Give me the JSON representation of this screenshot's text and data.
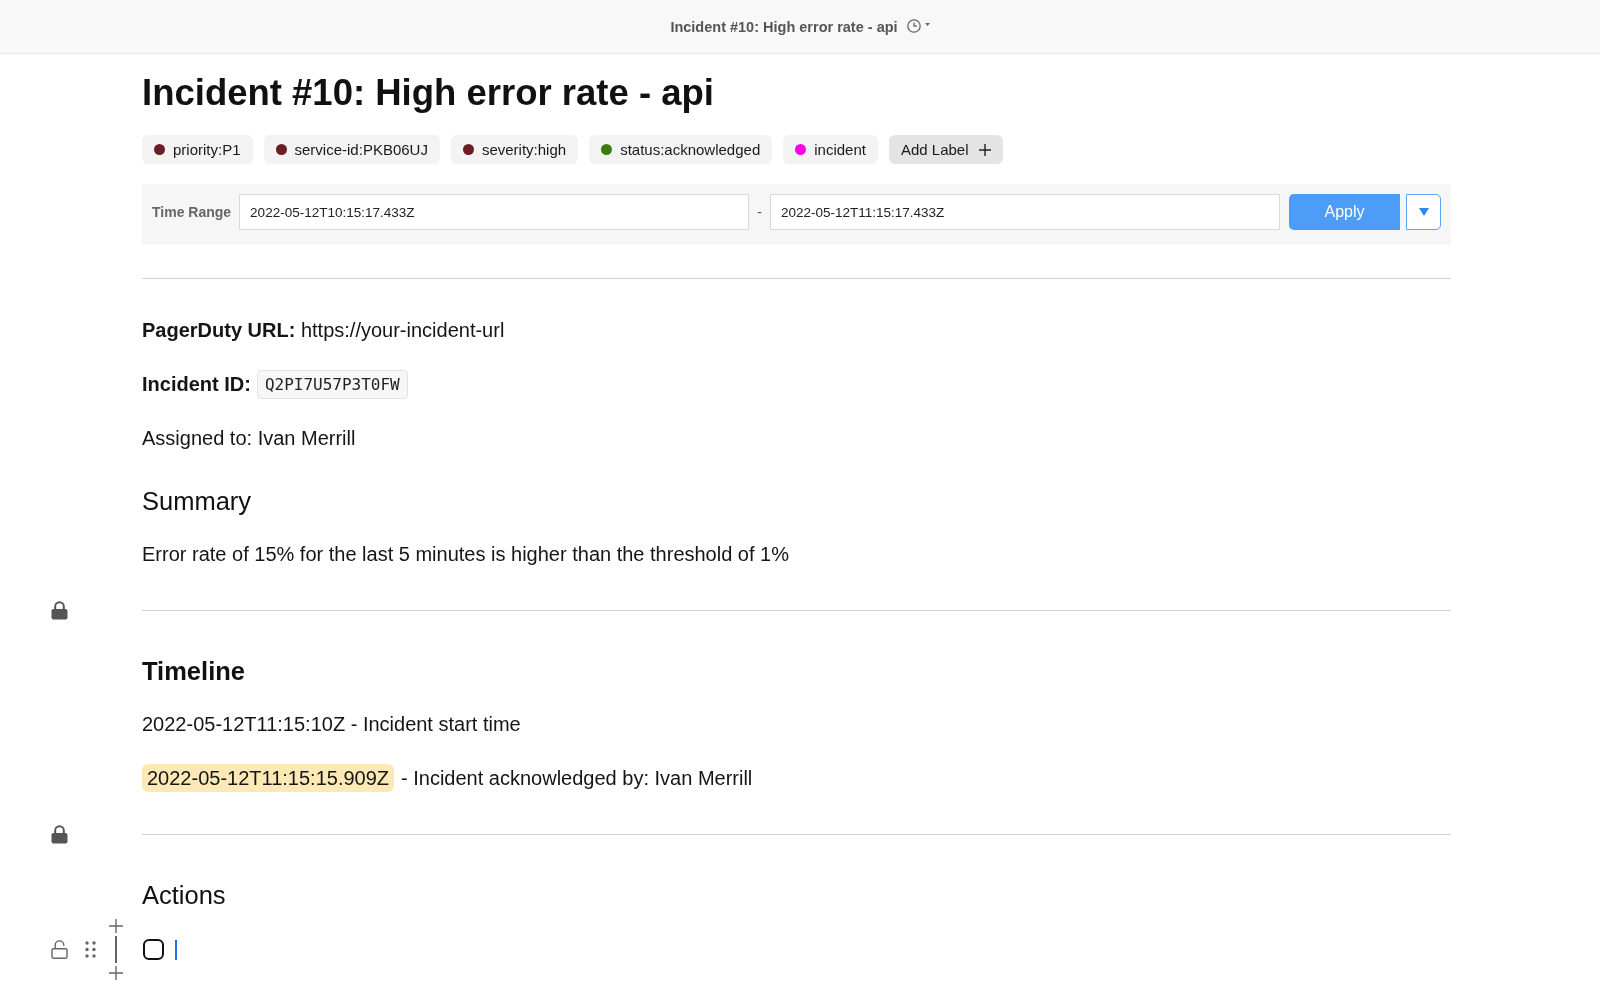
{
  "window": {
    "title": "Incident #10: High error rate - api"
  },
  "document": {
    "title": "Incident #10: High error rate - api",
    "labels": [
      {
        "text": "priority:P1",
        "color": "#6b1d26"
      },
      {
        "text": "service-id:PKB06UJ",
        "color": "#6b1d26"
      },
      {
        "text": "severity:high",
        "color": "#6b1d26"
      },
      {
        "text": "status:acknowledged",
        "color": "#3f7a0c"
      },
      {
        "text": "incident",
        "color": "#ff00e6"
      }
    ],
    "add_label_button": "Add Label",
    "time_range": {
      "label": "Time Range",
      "start": "2022-05-12T10:15:17.433Z",
      "separator": "-",
      "end": "2022-05-12T11:15:17.433Z",
      "apply_button": "Apply"
    },
    "blocks": [
      {
        "kind": "divider"
      },
      {
        "kind": "text",
        "text": "**PagerDuty URL:** https://your-incident-url"
      },
      {
        "kind": "code_field",
        "label": "Incident ID:",
        "code": "Q2PI7U57P3T0FW"
      },
      {
        "kind": "text",
        "text": "Assigned to: Ivan Merrill"
      },
      {
        "kind": "heading",
        "text": "Summary",
        "bold": false
      },
      {
        "kind": "text",
        "text": "Error rate of 15% for the last 5 minutes is higher than the threshold of 1%"
      },
      {
        "kind": "divider",
        "locked": true
      },
      {
        "kind": "heading",
        "text": "Timeline",
        "bold": true
      },
      {
        "kind": "text",
        "text": "2022-05-12T11:15:10Z - Incident start time"
      },
      {
        "kind": "timestamp_text",
        "timestamp": "2022-05-12T11:15:15.909Z",
        "text": "- Incident acknowledged by: Ivan Merrill"
      },
      {
        "kind": "divider",
        "locked": true
      },
      {
        "kind": "heading",
        "text": "Actions",
        "bold": false
      },
      {
        "kind": "checkbox",
        "checked": false,
        "locked": false,
        "focused": true
      }
    ]
  }
}
